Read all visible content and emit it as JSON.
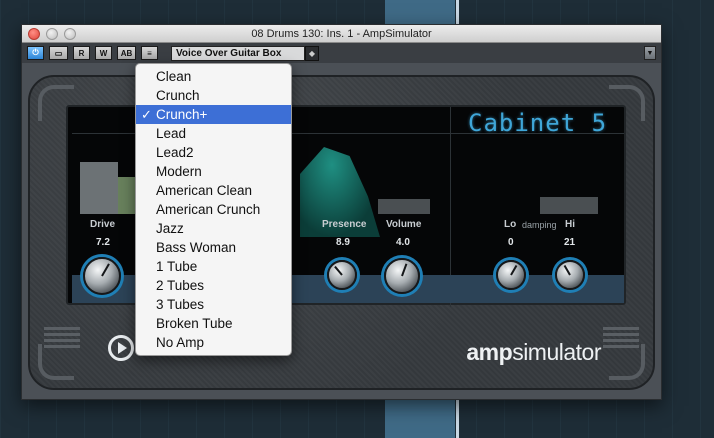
{
  "window": {
    "title": "08 Drums 130: Ins. 1 - AmpSimulator",
    "buttons": [
      "close",
      "minimize",
      "zoom"
    ]
  },
  "toolbar": {
    "power_icon": "power-icon",
    "bypass_icon": "bypass-icon",
    "read_label": "R",
    "write_label": "W",
    "ab_label": "AB",
    "compare_icon": "compare-icon",
    "preset_name": "Voice Over Guitar Box",
    "preset_arrow": "◆"
  },
  "amp": {
    "cabinet_display": "Cabinet 5",
    "controls": [
      {
        "label": "Drive",
        "value": "7.2"
      },
      {
        "label": "Presence",
        "value": "8.9"
      },
      {
        "label": "Volume",
        "value": "4.0"
      }
    ],
    "damping": {
      "label": "damping",
      "lo_label": "Lo",
      "lo_value": "0",
      "hi_label": "Hi",
      "hi_value": "21"
    },
    "brand": {
      "bold": "amp",
      "light": "simulator"
    }
  },
  "menu": {
    "items": [
      {
        "label": "Clean",
        "selected": false
      },
      {
        "label": "Crunch",
        "selected": false
      },
      {
        "label": "Crunch+",
        "selected": true
      },
      {
        "label": "Lead",
        "selected": false
      },
      {
        "label": "Lead2",
        "selected": false
      },
      {
        "label": "Modern",
        "selected": false
      },
      {
        "label": "American Clean",
        "selected": false
      },
      {
        "label": "American Crunch",
        "selected": false
      },
      {
        "label": "Jazz",
        "selected": false
      },
      {
        "label": "Bass Woman",
        "selected": false
      },
      {
        "label": "1 Tube",
        "selected": false
      },
      {
        "label": "2 Tubes",
        "selected": false
      },
      {
        "label": "3 Tubes",
        "selected": false
      },
      {
        "label": "Broken Tube",
        "selected": false
      },
      {
        "label": "No Amp",
        "selected": false
      }
    ],
    "checkmark": "✓"
  },
  "colors": {
    "accent": "#3d6fd6",
    "display": "#3fa6d8",
    "knob_ring": "#1f7fb5"
  }
}
